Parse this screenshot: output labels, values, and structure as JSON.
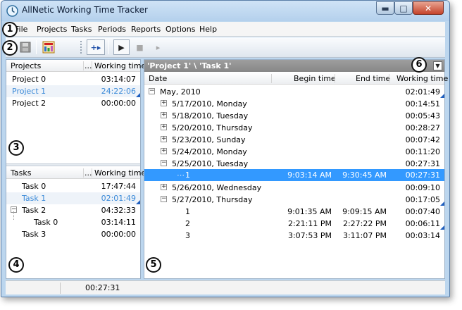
{
  "window": {
    "title": "AllNetic Working Time Tracker"
  },
  "caption_buttons": {
    "minimize": "▬",
    "maximize": "□",
    "close": "✕"
  },
  "menu": [
    "File",
    "Projects",
    "Tasks",
    "Periods",
    "Reports",
    "Options",
    "Help"
  ],
  "toolbar": {
    "add_label": "+▸",
    "play_label": "▶",
    "stop_label": "■",
    "step_label": "▸"
  },
  "projects_panel": {
    "col_name": "Projects",
    "col_more": "...",
    "col_time": "Working time",
    "rows": [
      {
        "name": "Project 0",
        "time": "03:14:07"
      },
      {
        "name": "Project 1",
        "time": "24:22:06"
      },
      {
        "name": "Project 2",
        "time": "00:00:00"
      }
    ]
  },
  "tasks_panel": {
    "col_name": "Tasks",
    "col_more": "...",
    "col_time": "Working time",
    "rows": [
      {
        "name": "Task 0",
        "time": "17:47:44"
      },
      {
        "name": "Task 1",
        "time": "02:01:49"
      },
      {
        "name": "Task 2",
        "time": "04:32:33"
      },
      {
        "name": "Task 0",
        "time": "03:14:11"
      },
      {
        "name": "Task 3",
        "time": "00:00:00"
      }
    ]
  },
  "detail_panel": {
    "breadcrumb": "'Project 1' \\ 'Task 1'",
    "col_date": "Date",
    "col_begin": "Begin time",
    "col_end": "End time",
    "col_time": "Working time",
    "rows": [
      {
        "date": "May, 2010",
        "begin": "",
        "end": "",
        "time": "02:01:49"
      },
      {
        "date": "5/17/2010, Monday",
        "begin": "",
        "end": "",
        "time": "00:14:51"
      },
      {
        "date": "5/18/2010, Tuesday",
        "begin": "",
        "end": "",
        "time": "00:05:43"
      },
      {
        "date": "5/20/2010, Thursday",
        "begin": "",
        "end": "",
        "time": "00:28:27"
      },
      {
        "date": "5/23/2010, Sunday",
        "begin": "",
        "end": "",
        "time": "00:07:42"
      },
      {
        "date": "5/24/2010, Monday",
        "begin": "",
        "end": "",
        "time": "00:11:20"
      },
      {
        "date": "5/25/2010, Tuesday",
        "begin": "",
        "end": "",
        "time": "00:27:31"
      },
      {
        "date": "1",
        "begin": "9:03:14 AM",
        "end": "9:30:45 AM",
        "time": "00:27:31"
      },
      {
        "date": "5/26/2010, Wednesday",
        "begin": "",
        "end": "",
        "time": "00:09:10"
      },
      {
        "date": "5/27/2010, Thursday",
        "begin": "",
        "end": "",
        "time": "00:17:05"
      },
      {
        "date": "1",
        "begin": "9:01:35 AM",
        "end": "9:09:15 AM",
        "time": "00:07:40"
      },
      {
        "date": "2",
        "begin": "2:21:11 PM",
        "end": "2:27:22 PM",
        "time": "00:06:11"
      },
      {
        "date": "3",
        "begin": "3:07:53 PM",
        "end": "3:11:07 PM",
        "time": "00:03:14"
      }
    ]
  },
  "status": {
    "time": "00:27:31"
  },
  "callouts": [
    "1",
    "2",
    "3",
    "4",
    "5",
    "6"
  ],
  "colors": {
    "selected_text": "#3b8ad8",
    "highlight": "#3399ff",
    "breadcrumb_bg": "#8f8f8f"
  }
}
